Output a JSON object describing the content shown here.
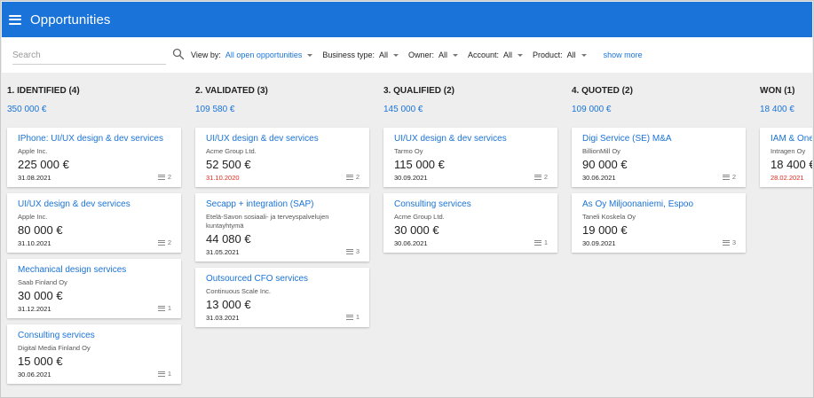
{
  "app": {
    "title": "Opportunities",
    "menu_icon": "hamburger-menu-icon"
  },
  "filters": {
    "search_placeholder": "Search",
    "view_by_label": "View by:",
    "view_by_value": "All open opportunities",
    "business_type_label": "Business type:",
    "business_type_value": "All",
    "owner_label": "Owner:",
    "owner_value": "All",
    "account_label": "Account:",
    "account_value": "All",
    "product_label": "Product:",
    "product_value": "All",
    "show_more": "show more"
  },
  "columns": [
    {
      "title": "1. IDENTIFIED (4)",
      "total": "350 000 €",
      "cards": [
        {
          "title": "IPhone: UI/UX design & dev services",
          "company": "Apple Inc.",
          "amount": "225 000 €",
          "date": "31.08.2021",
          "overdue": false,
          "count": "2"
        },
        {
          "title": "UI/UX design & dev services",
          "company": "Apple Inc.",
          "amount": "80 000 €",
          "date": "31.10.2021",
          "overdue": false,
          "count": "2"
        },
        {
          "title": "Mechanical design services",
          "company": "Saab Finland Oy",
          "amount": "30 000 €",
          "date": "31.12.2021",
          "overdue": false,
          "count": "1"
        },
        {
          "title": "Consulting services",
          "company": "Digital Media Finland Oy",
          "amount": "15 000 €",
          "date": "30.06.2021",
          "overdue": false,
          "count": "1"
        }
      ]
    },
    {
      "title": "2. VALIDATED (3)",
      "total": "109 580 €",
      "cards": [
        {
          "title": "UI/UX design & dev services",
          "company": "Acme Group Ltd.",
          "amount": "52 500 €",
          "date": "31.10.2020",
          "overdue": true,
          "count": "2"
        },
        {
          "title": "Secapp + integration (SAP)",
          "company": "Etelä-Savon sosiaali- ja terveyspalvelujen kuntayhtymä",
          "amount": "44 080 €",
          "date": "31.05.2021",
          "overdue": false,
          "count": "3"
        },
        {
          "title": "Outsourced CFO services",
          "company": "Continuous Scale Inc.",
          "amount": "13 000 €",
          "date": "31.03.2021",
          "overdue": false,
          "count": "1"
        }
      ]
    },
    {
      "title": "3. QUALIFIED (2)",
      "total": "145 000 €",
      "cards": [
        {
          "title": "UI/UX design & dev services",
          "company": "Tarmo Oy",
          "amount": "115 000 €",
          "date": "30.09.2021",
          "overdue": false,
          "count": "2"
        },
        {
          "title": "Consulting services",
          "company": "Acme Group Ltd.",
          "amount": "30 000 €",
          "date": "30.06.2021",
          "overdue": false,
          "count": "1"
        }
      ]
    },
    {
      "title": "4. QUOTED (2)",
      "total": "109 000 €",
      "cards": [
        {
          "title": "Digi Service (SE) M&A",
          "company": "BillionMill Oy",
          "amount": "90 000 €",
          "date": "30.06.2021",
          "overdue": false,
          "count": "2"
        },
        {
          "title": "As Oy Miljoonaniemi, Espoo",
          "company": "Taneli Koskela Oy",
          "amount": "19 000 €",
          "date": "30.09.2021",
          "overdue": false,
          "count": "3"
        }
      ]
    },
    {
      "title": "WON (1)",
      "total": "18 400 €",
      "cards": [
        {
          "title": "IAM & One",
          "company": "Intragen Oy",
          "amount": "18 400 €",
          "date": "28.02.2021",
          "overdue": true,
          "count": ""
        }
      ]
    }
  ]
}
